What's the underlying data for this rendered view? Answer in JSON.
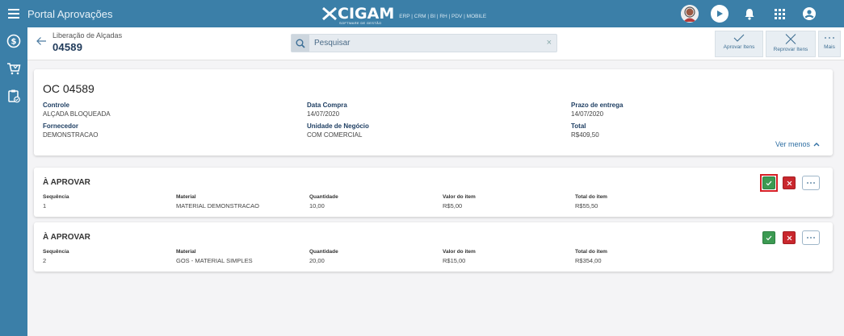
{
  "app": {
    "title": "Portal Aprovações"
  },
  "brand": {
    "name": "CIGAM",
    "tagline": "SOFTWARE DE GESTÃO",
    "products": "ERP | CRM | BI | RH | PDV | MOBILE"
  },
  "header": {
    "breadcrumb": "Liberação de Alçadas",
    "number": "04589",
    "search_placeholder": "Pesquisar",
    "actions": [
      {
        "label": "Aprovar Itens",
        "icon": "check-icon"
      },
      {
        "label": "Reprovar Itens",
        "icon": "close-icon"
      },
      {
        "label": "Mais",
        "icon": "more-icon"
      }
    ]
  },
  "order": {
    "title": "OC 04589",
    "fields": {
      "controle": {
        "label": "Controle",
        "value": "ALÇADA BLOQUEADA"
      },
      "data_compra": {
        "label": "Data Compra",
        "value": "14/07/2020"
      },
      "prazo_entrega": {
        "label": "Prazo de entrega",
        "value": "14/07/2020"
      },
      "fornecedor": {
        "label": "Fornecedor",
        "value": "DEMONSTRACAO"
      },
      "unidade_negocio": {
        "label": "Unidade de Negócio",
        "value": "COM COMERCIAL"
      },
      "total": {
        "label": "Total",
        "value": "R$409,50"
      }
    },
    "toggle_label": "Ver menos"
  },
  "item_columns": [
    "Sequência",
    "Material",
    "Quantidade",
    "Valor do item",
    "Total do item"
  ],
  "items": [
    {
      "status": "À APROVAR",
      "sequencia": "1",
      "material": "MATERIAL DEMONSTRACAO",
      "quantidade": "10,00",
      "valor": "R$5,00",
      "total": "R$55,50"
    },
    {
      "status": "À APROVAR",
      "sequencia": "2",
      "material": "GOS - MATERIAL SIMPLES",
      "quantidade": "20,00",
      "valor": "R$15,00",
      "total": "R$354,00"
    }
  ],
  "colors": {
    "primary": "#3b7fa8",
    "approve": "#3c9a52",
    "reject": "#c9272d",
    "highlight": "#d61f26"
  }
}
